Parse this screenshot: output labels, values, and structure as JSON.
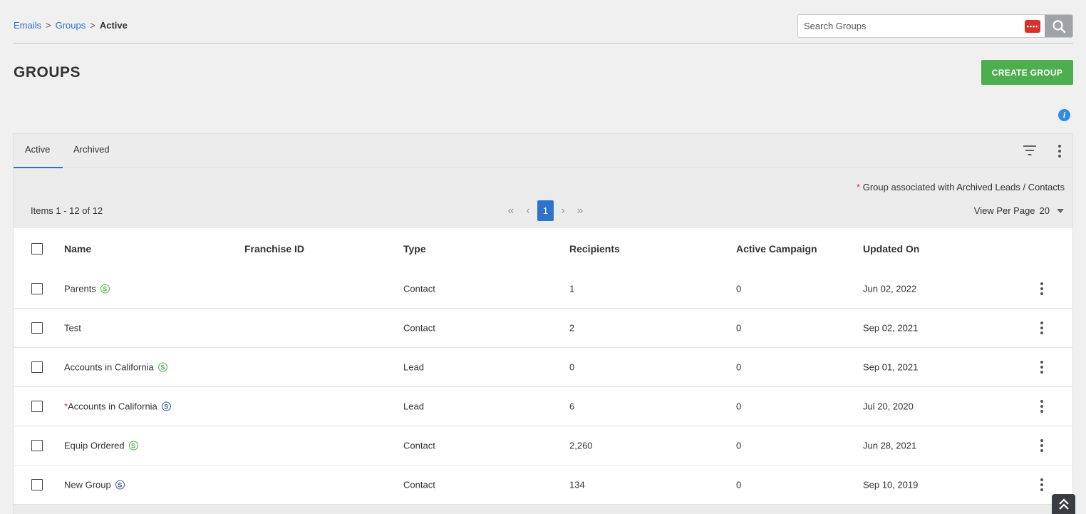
{
  "breadcrumb": {
    "items": [
      "Emails",
      "Groups"
    ],
    "sep": ">",
    "current": "Active"
  },
  "search": {
    "placeholder": "Search Groups",
    "badge": "••••"
  },
  "page": {
    "title": "GROUPS",
    "create_label": "CREATE GROUP",
    "info": "i"
  },
  "tabs": [
    {
      "label": "Active",
      "active": true
    },
    {
      "label": "Archived",
      "active": false
    }
  ],
  "note": {
    "star": "*",
    "text": " Group associated with Archived Leads / Contacts"
  },
  "pagination": {
    "items_text": "Items 1 - 12 of 12",
    "current_page": "1",
    "first": "«",
    "prev": "‹",
    "next": "›",
    "last": "»"
  },
  "view_per_page": {
    "label": "View Per Page",
    "value": "20"
  },
  "columns": [
    "Name",
    "Franchise ID",
    "Type",
    "Recipients",
    "Active Campaign",
    "Updated On"
  ],
  "rows": [
    {
      "star": "",
      "name": "Parents",
      "badge": "S",
      "badge_color": "green",
      "franchise_id": "",
      "type": "Contact",
      "recipients": "1",
      "active_campaign": "0",
      "updated_on": "Jun 02, 2022"
    },
    {
      "star": "",
      "name": "Test",
      "badge": "",
      "badge_color": "",
      "franchise_id": "",
      "type": "Contact",
      "recipients": "2",
      "active_campaign": "0",
      "updated_on": "Sep 02, 2021"
    },
    {
      "star": "",
      "name": "Accounts in California",
      "badge": "S",
      "badge_color": "green",
      "franchise_id": "",
      "type": "Lead",
      "recipients": "0",
      "active_campaign": "0",
      "updated_on": "Sep 01, 2021"
    },
    {
      "star": "*",
      "name": "Accounts in California",
      "badge": "S",
      "badge_color": "blue",
      "franchise_id": "",
      "type": "Lead",
      "recipients": "6",
      "active_campaign": "0",
      "updated_on": "Jul 20, 2020"
    },
    {
      "star": "",
      "name": "Equip Ordered",
      "badge": "S",
      "badge_color": "green",
      "franchise_id": "",
      "type": "Contact",
      "recipients": "2,260",
      "active_campaign": "0",
      "updated_on": "Jun 28, 2021"
    },
    {
      "star": "",
      "name": "New Group",
      "badge": "S",
      "badge_color": "blue",
      "franchise_id": "",
      "type": "Contact",
      "recipients": "134",
      "active_campaign": "0",
      "updated_on": "Sep 10, 2019"
    }
  ],
  "colors": {
    "link": "#2f73c9",
    "primary_button": "#4cae4f",
    "accent_blue": "#2f73c9",
    "badge_green": "#4cae4f",
    "badge_blue": "#3a5a8c",
    "required_star": "#d9302c"
  },
  "icons": {
    "search": "search-icon",
    "filter": "filter-icon",
    "kebab": "more-vertical-icon",
    "info": "info-icon",
    "scroll_top": "double-chevron-up-icon",
    "password": "password-manager-icon"
  }
}
